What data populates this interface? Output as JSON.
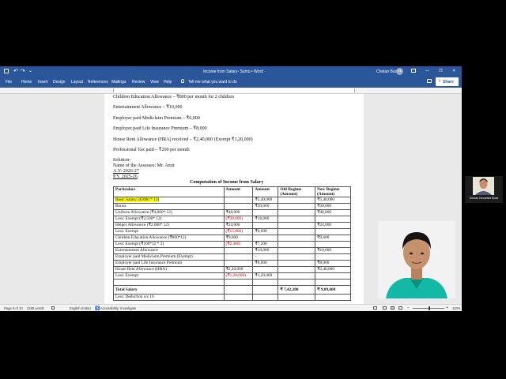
{
  "window": {
    "title": "Income from Salary- Sumo  •  Word",
    "user": "Chetan Bose",
    "user_initials": "CB",
    "share_label": "Share",
    "minimize_glyph": "—",
    "restore_glyph": "❐",
    "close_glyph": "✕"
  },
  "ribbon": {
    "tabs": [
      "File",
      "Home",
      "Insert",
      "Design",
      "Layout",
      "References",
      "Mailings",
      "Review",
      "View",
      "Help"
    ],
    "tell_me": "Tell me what you want to do"
  },
  "document": {
    "lines": [
      "Children Education Allowance – ₹800 per month for 2 children",
      "Entertainment Allowance – ₹10,000",
      "Employer paid Mediclaim Premium – ₹6,000",
      "Employer paid Life Insurance Premium – ₹8,000",
      "House Rent Allowance (HRA) received – ₹2,40,000 (Exempt ₹1,20,000)",
      "Professional Tax paid – ₹200 per month"
    ],
    "solution": "Solution-",
    "assessee": "Name of the Assessee: Mr. Amit",
    "ay": "A.Y: 2026-27",
    "py": "P.Y. 2025-26",
    "table_title": "Computation of Income from Salary",
    "headers": [
      "Particulars",
      "Amount",
      "Amount",
      "Old Regime (Amount)",
      "New Regime (Amount)"
    ],
    "header_old_1": "Old Regime",
    "header_old_2": "(Amount)",
    "header_new_1": "New Regime",
    "header_new_2": "(Amount)",
    "rows": [
      [
        "Basic Salary (45000 * 12)",
        "",
        "₹5,40,000",
        "",
        "₹5,40,000"
      ],
      [
        "Bonus",
        "",
        "₹30,000",
        "",
        "₹30,000"
      ],
      [
        "Uniform Allowance (₹4,000* 12)",
        "₹48,000",
        "",
        "",
        "₹48,000"
      ],
      [
        "Less: Exempt (₹2,500* 12)",
        "(₹30,000)",
        "₹18,000",
        "",
        ""
      ],
      [
        "Helper Allowance (₹2,000* 12)",
        "₹24,000",
        "",
        "",
        "₹24,000"
      ],
      [
        "Less: Exempt",
        "(₹15,000)",
        "₹9,000",
        "",
        ""
      ],
      [
        "Children Education Allowance (₹800*12)",
        "₹9,600",
        "",
        "",
        "₹9,600"
      ],
      [
        "Less: Exempt (₹100*12 * 2)",
        "(₹2,400)",
        "₹7,200",
        "",
        ""
      ],
      [
        "Entertainment Allowance",
        "",
        "₹10,000",
        "",
        "₹10,000"
      ],
      [
        "Employer paid Mediclaim Premium (Exempt)",
        "",
        "-",
        "",
        "-"
      ],
      [
        "Employer paid Life Insurance Premium",
        "",
        "₹8,000",
        "",
        "₹8,000"
      ],
      [
        "House Rent Allowance (HRA)",
        "₹2,40,000",
        "",
        "",
        "₹2,40,000"
      ],
      [
        "Less: Exempt",
        "(₹1,20,000)",
        "₹1,20,000",
        "",
        ""
      ]
    ],
    "total_label": "Total Salary",
    "total_old": "₹ 7,42,200",
    "total_new": "₹ 9,09,600",
    "next_line": "Less: Deduction u/s 16"
  },
  "status": {
    "page": "Page 8 of 10",
    "words": "2186 words",
    "language": "English (India)",
    "accessibility": "Accessibility: Investigate",
    "zoom": "110%"
  },
  "participant": {
    "name": "Chetan Devarishi Bose"
  }
}
